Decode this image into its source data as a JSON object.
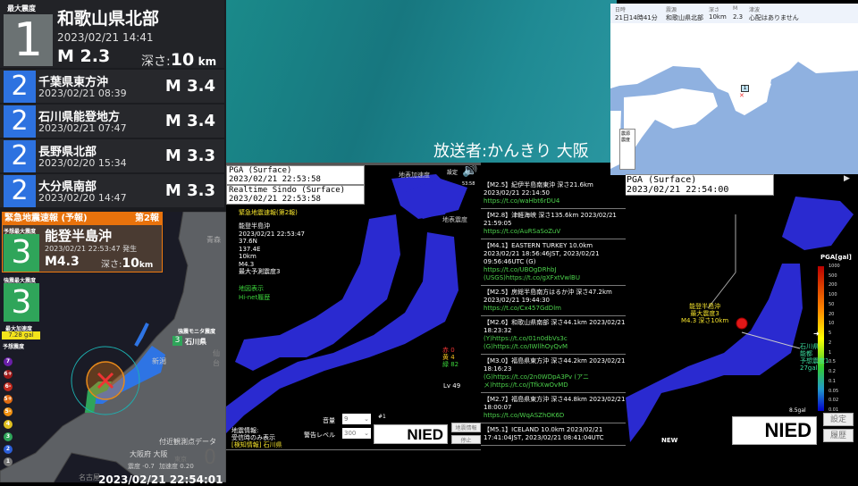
{
  "latest": {
    "label": "最大震度",
    "intensity": "1",
    "region": "和歌山県北部",
    "datetime": "2023/02/21  14:41",
    "magnitude": "M 2.3",
    "depth_label": "深さ:",
    "depth_value": "10",
    "depth_unit": "km",
    "color": "#6b7273"
  },
  "history": [
    {
      "intensity": "2",
      "region": "千葉県東方沖",
      "datetime": "2023/02/21  08:39",
      "magnitude": "M 3.4"
    },
    {
      "intensity": "2",
      "region": "石川県能登地方",
      "datetime": "2023/02/21  07:47",
      "magnitude": "M 3.4"
    },
    {
      "intensity": "2",
      "region": "長野県北部",
      "datetime": "2023/02/20  15:34",
      "magnitude": "M 3.3"
    },
    {
      "intensity": "2",
      "region": "大分県南部",
      "datetime": "2023/02/20  14:47",
      "magnitude": "M 3.3"
    }
  ],
  "eew": {
    "title": "緊急地震速報 (予報)",
    "report_no": "第2報",
    "pred_label": "予想最大震度",
    "pred_intensity": "3",
    "region": "能登半島沖",
    "datetime": "2023/02/21 22:53:47 発生",
    "magnitude": "M4.3",
    "depth_label": "深さ:",
    "depth_value": "10",
    "depth_unit": "km",
    "obs_label": "強震最大震度",
    "obs_intensity": "3",
    "pga_label": "最大加速度",
    "pga_value": "7.28 gal",
    "scale_label": "予想震度",
    "scale": [
      "7",
      "6+",
      "6-",
      "5+",
      "5-",
      "4",
      "3",
      "2",
      "1"
    ],
    "monitor_label": "強震モニタ震度",
    "monitor_intensity": "3",
    "monitor_pref": "石川県",
    "map_labels": {
      "aomori": "青森",
      "niigata": "新潟",
      "sendai": "仙台",
      "nagoya": "名古屋",
      "tokyo": "東京"
    },
    "nearby_title": "付近観測点データ",
    "nearby_station": "大阪府 大阪",
    "nearby_shindo": "震度 -0.7",
    "nearby_accel": "加速度 0.20",
    "nearby_big": "0",
    "clock": "2023/02/21 22:54:01"
  },
  "caster": "放送者:かんきり  大阪",
  "kmap": {
    "col1_label": "日時",
    "col1": "21日14時41分",
    "col2_label": "震源",
    "col2": "和歌山県北部",
    "col3_label": "深さ",
    "col3": "10km",
    "col4_label": "M",
    "col4": "2.3",
    "col5_label": "津波",
    "col5": "心配はありません",
    "legend_epicenter": "震源",
    "legend_intensity": "震度",
    "marker": "1"
  },
  "pga1": {
    "title1": "PGA (Surface)",
    "time1": "2023/02/21 22:53:58",
    "title2": "Realtime Sindo (Surface)",
    "time2": "2023/02/21 22:53:58",
    "label_accel": "地表加速度",
    "label_sindo": "地表震度",
    "settings": "設定",
    "clock": "53:58",
    "eew_title": "緊急地震速報(第2報)",
    "eew_lines": [
      "能登半島沖",
      "2023/02/21 22:53:47",
      "37.6N",
      "137.4E",
      "10km",
      "M4.3",
      "最大予測震度3"
    ],
    "link1": "地図表示",
    "link2": "Hi-net履歴",
    "red": "赤 0",
    "yellow": "黄 4",
    "green": "緑 82",
    "level": "Lv 49",
    "vol_label": "音量",
    "vol_value": "9",
    "warn_label": "警告レベル",
    "warn_value": "300",
    "num": "#1",
    "btn_info": "地震情報",
    "btn_stop": "停止",
    "q_label1": "地震情報:",
    "q_label2": "受信時のみ表示",
    "q_alert": "[検知情報] 石川県",
    "logo": "NIED"
  },
  "tweets": [
    {
      "text": "【M2.5】紀伊半島南東沖 深さ21.6km 2023/02/21 22:14:50",
      "links": [
        "https://t.co/waHbt6rDU4"
      ]
    },
    {
      "text": "【M2.8】津軽海峡 深さ135.6km 2023/02/21 21:59:05",
      "links": [
        "https://t.co/AuRSaSoZuV"
      ]
    },
    {
      "text": "【M4.1】EASTERN TURKEY 10.0km 2023/02/21 18:56:46JST, 2023/02/21 09:56:46UTC (G)",
      "links": [
        "https://t.co/UBOgDRhbJ",
        "(USGS)https://t.co/gXFxtVwlBU"
      ]
    },
    {
      "text": "【M2.5】房総半島南方はるか沖 深さ47.2km 2023/02/21 19:44:30",
      "links": [
        "https://t.co/Cx457GdDlm"
      ]
    },
    {
      "text": "【M2.6】和歌山県南部 深さ44.1km 2023/02/21 18:23:32",
      "links": [
        "(Y)https://t.co/01n0dbVs3c",
        "(G)https://t.co/IWllhOyQvM"
      ]
    },
    {
      "text": "【M3.0】福島県東方沖 深さ44.2km 2023/02/21 18:16:23",
      "links": [
        "(G)https://t.co/2n0WDpA3Pv (アニメ)https://t.co/jTfkXwOvMD"
      ]
    },
    {
      "text": "【M2.7】福島県東方沖 深さ44.8km 2023/02/21 18:00:07",
      "links": [
        "https://t.co/WqASZhOK6D"
      ]
    },
    {
      "text": "【M5.1】ICELAND 10.0km 2023/02/21 17:41:04JST, 2023/02/21 08:41:04UTC",
      "links": []
    }
  ],
  "pga2": {
    "title": "PGA (Surface)",
    "time": "2023/02/21 22:54:00",
    "callout": [
      "能登半島沖",
      "最大震度3",
      "M4.3 深さ10km"
    ],
    "station": [
      "石川県",
      "能都",
      "予想震度1",
      "27gal"
    ],
    "legend_title": "PGA[gal]",
    "legend_ticks": [
      "1000",
      "500",
      "200",
      "100",
      "50",
      "20",
      "10",
      "5",
      "2",
      "1",
      "0.5",
      "0.2",
      "0.1",
      "0.05",
      "0.02",
      "0.01"
    ],
    "current": "8.5gal",
    "new_label": "NEW",
    "btn_settings": "設定",
    "btn_history": "履歴",
    "logo": "NIED"
  }
}
